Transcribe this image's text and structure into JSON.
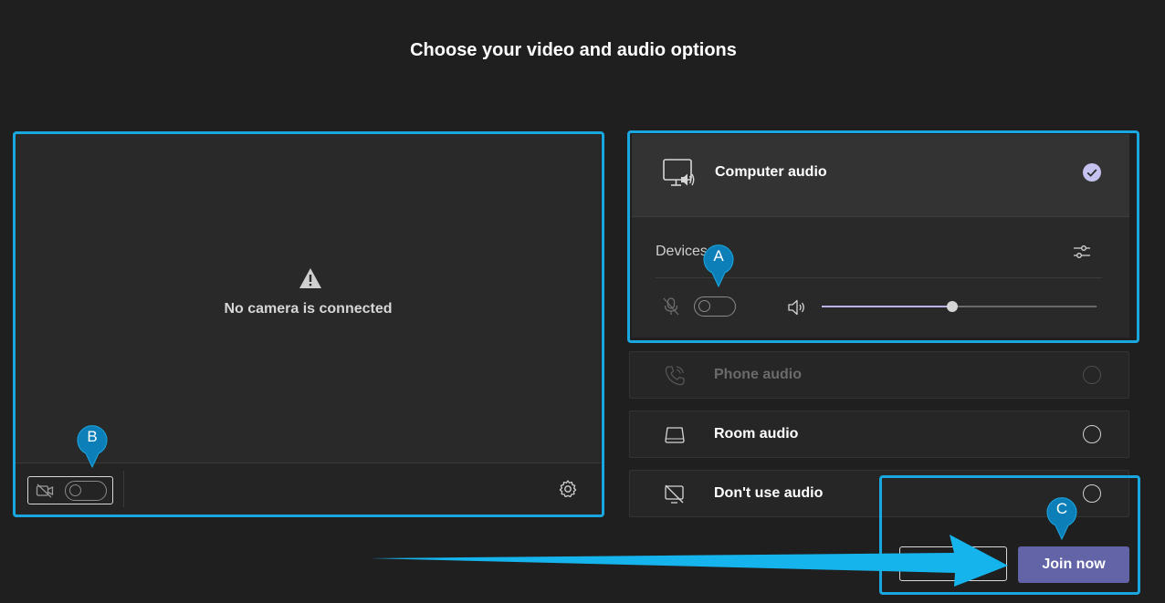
{
  "page": {
    "title": "Choose your video and audio options"
  },
  "video": {
    "no_camera_message": "No camera is connected",
    "camera_toggle_on": false,
    "icons": {
      "warning": "warning-icon",
      "camera_off": "camera-off-icon",
      "settings": "gear-icon"
    }
  },
  "audio": {
    "computer_audio": {
      "label": "Computer audio",
      "selected": true
    },
    "devices_label": "Devices",
    "mic_toggle_on": false,
    "volume_level": 0.5,
    "options": [
      {
        "label": "Phone audio",
        "enabled": false,
        "icon": "phone-icon"
      },
      {
        "label": "Room audio",
        "enabled": true,
        "icon": "room-icon"
      },
      {
        "label": "Don't use audio",
        "enabled": true,
        "icon": "no-audio-icon"
      }
    ]
  },
  "actions": {
    "join_label": "Join now",
    "cancel_label": ""
  },
  "annotations": {
    "a": "A",
    "b": "B",
    "c": "C"
  },
  "colors": {
    "accent": "#6264a7",
    "highlight": "#1aa7e0",
    "background": "#1f1f1f"
  }
}
